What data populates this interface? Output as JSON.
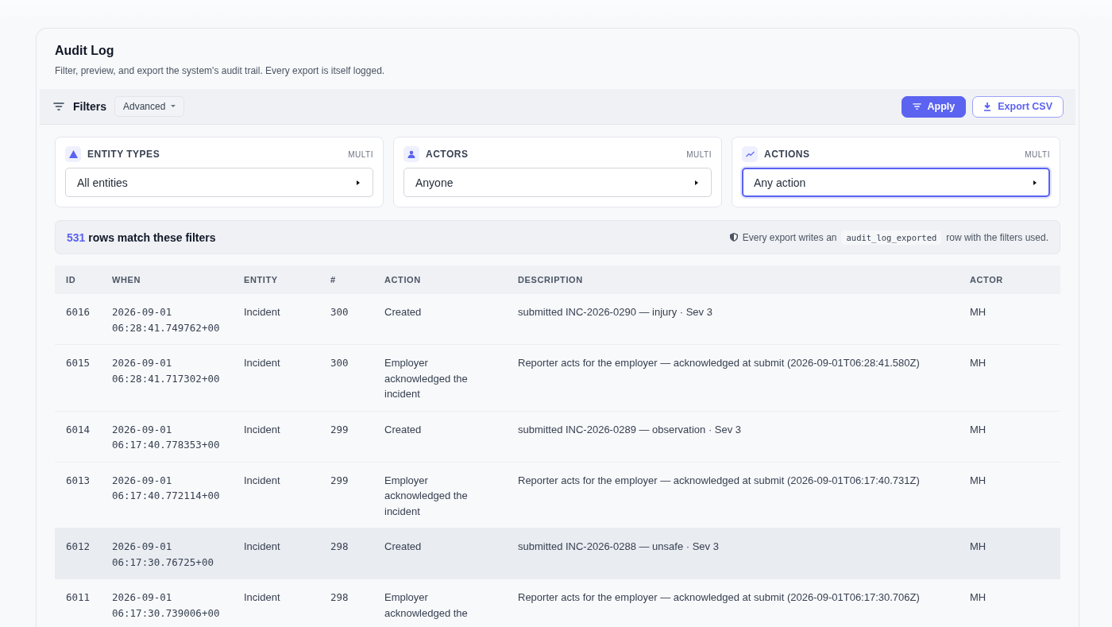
{
  "header": {
    "title": "Audit Log",
    "subtitle": "Filter, preview, and export the system's audit trail. Every export is itself logged."
  },
  "filter_bar": {
    "title": "Filters",
    "mode": "Advanced",
    "buttons": [
      {
        "kind": "primary",
        "label": "Apply"
      },
      {
        "kind": "outline",
        "label": "Export CSV"
      }
    ]
  },
  "filters": [
    {
      "kind": "entity",
      "label": "ENTITY TYPES",
      "badge": "MULTI",
      "value": "All entities",
      "focused": false
    },
    {
      "kind": "actor",
      "label": "ACTORS",
      "badge": "MULTI",
      "value": "Anyone",
      "focused": false
    },
    {
      "kind": "action",
      "label": "ACTIONS",
      "badge": "MULTI",
      "value": "Any action",
      "focused": true
    }
  ],
  "summary": {
    "count": "531",
    "text": "rows match these filters",
    "note_before": "Every export writes an",
    "note_code": "audit_log_exported",
    "note_after": "row with the filters used."
  },
  "table": {
    "columns": [
      "ID",
      "WHEN",
      "ENTITY",
      "#",
      "ACTION",
      "DESCRIPTION",
      "ACTOR"
    ],
    "rows": [
      {
        "selected": false,
        "cells": [
          "6016",
          "2026-09-01 06:28:41.749762+00",
          "Incident",
          "300",
          "Created",
          "submitted INC-2026-0290 — injury · Sev 3",
          "MH"
        ]
      },
      {
        "selected": false,
        "cells": [
          "6015",
          "2026-09-01 06:28:41.717302+00",
          "Incident",
          "300",
          "Employer acknowledged the incident",
          "Reporter acts for the employer — acknowledged at submit (2026-09-01T06:28:41.580Z)",
          "MH"
        ]
      },
      {
        "selected": false,
        "cells": [
          "6014",
          "2026-09-01 06:17:40.778353+00",
          "Incident",
          "299",
          "Created",
          "submitted INC-2026-0289 — observation · Sev 3",
          "MH"
        ]
      },
      {
        "selected": false,
        "cells": [
          "6013",
          "2026-09-01 06:17:40.772114+00",
          "Incident",
          "299",
          "Employer acknowledged the incident",
          "Reporter acts for the employer — acknowledged at submit (2026-09-01T06:17:40.731Z)",
          "MH"
        ]
      },
      {
        "selected": true,
        "cells": [
          "6012",
          "2026-09-01 06:17:30.76725+00",
          "Incident",
          "298",
          "Created",
          "submitted INC-2026-0288 — unsafe · Sev 3",
          "MH"
        ]
      },
      {
        "selected": false,
        "cells": [
          "6011",
          "2026-09-01 06:17:30.739006+00",
          "Incident",
          "298",
          "Employer acknowledged the",
          "Reporter acts for the employer — acknowledged at submit (2026-09-01T06:17:30.706Z)",
          "MH"
        ]
      }
    ]
  }
}
